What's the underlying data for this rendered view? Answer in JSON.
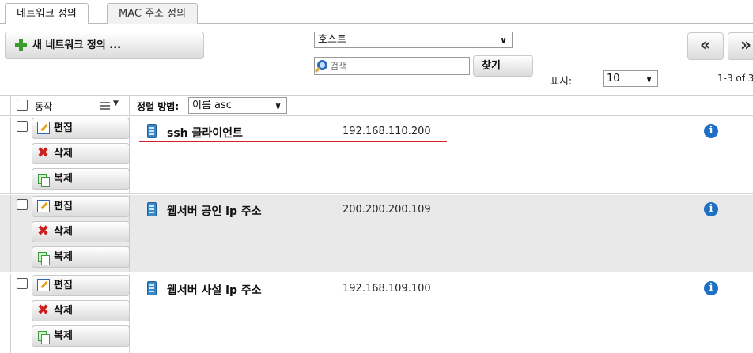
{
  "tabs": [
    {
      "label": "네트워크 정의"
    },
    {
      "label": "MAC 주소 정의"
    }
  ],
  "toolbar": {
    "add_label": "새 네트워크 정의 ...",
    "host_filter": "호스트",
    "search_placeholder": "검색",
    "find_label": "찾기",
    "first_label": "«",
    "next_label": "»",
    "display_label": "표시:",
    "display_value": "10",
    "page_count": "1-3 of 3"
  },
  "table_header": {
    "action_label": "동작",
    "sort_label": "정렬 방법:",
    "sort_value": "이름 asc"
  },
  "rows": [
    {
      "name": "ssh 클라이언트",
      "ip": "192.168.110.200",
      "edit": "편집",
      "delete": "삭제",
      "duplicate": "복제"
    },
    {
      "name": "웹서버 공인 ip 주소",
      "ip": "200.200.200.109",
      "edit": "편집",
      "delete": "삭제",
      "duplicate": "복제"
    },
    {
      "name": "웹서버 사설 ip 주소",
      "ip": "192.168.109.100",
      "edit": "편집",
      "delete": "삭제",
      "duplicate": "복제"
    }
  ],
  "icons": {
    "info": "i",
    "delete": "✖",
    "chevron": "⌄"
  },
  "colors": {
    "highlight_underline": "#d4202b",
    "info_blue": "#1f6fc4",
    "add_green": "#3d9a2e"
  }
}
